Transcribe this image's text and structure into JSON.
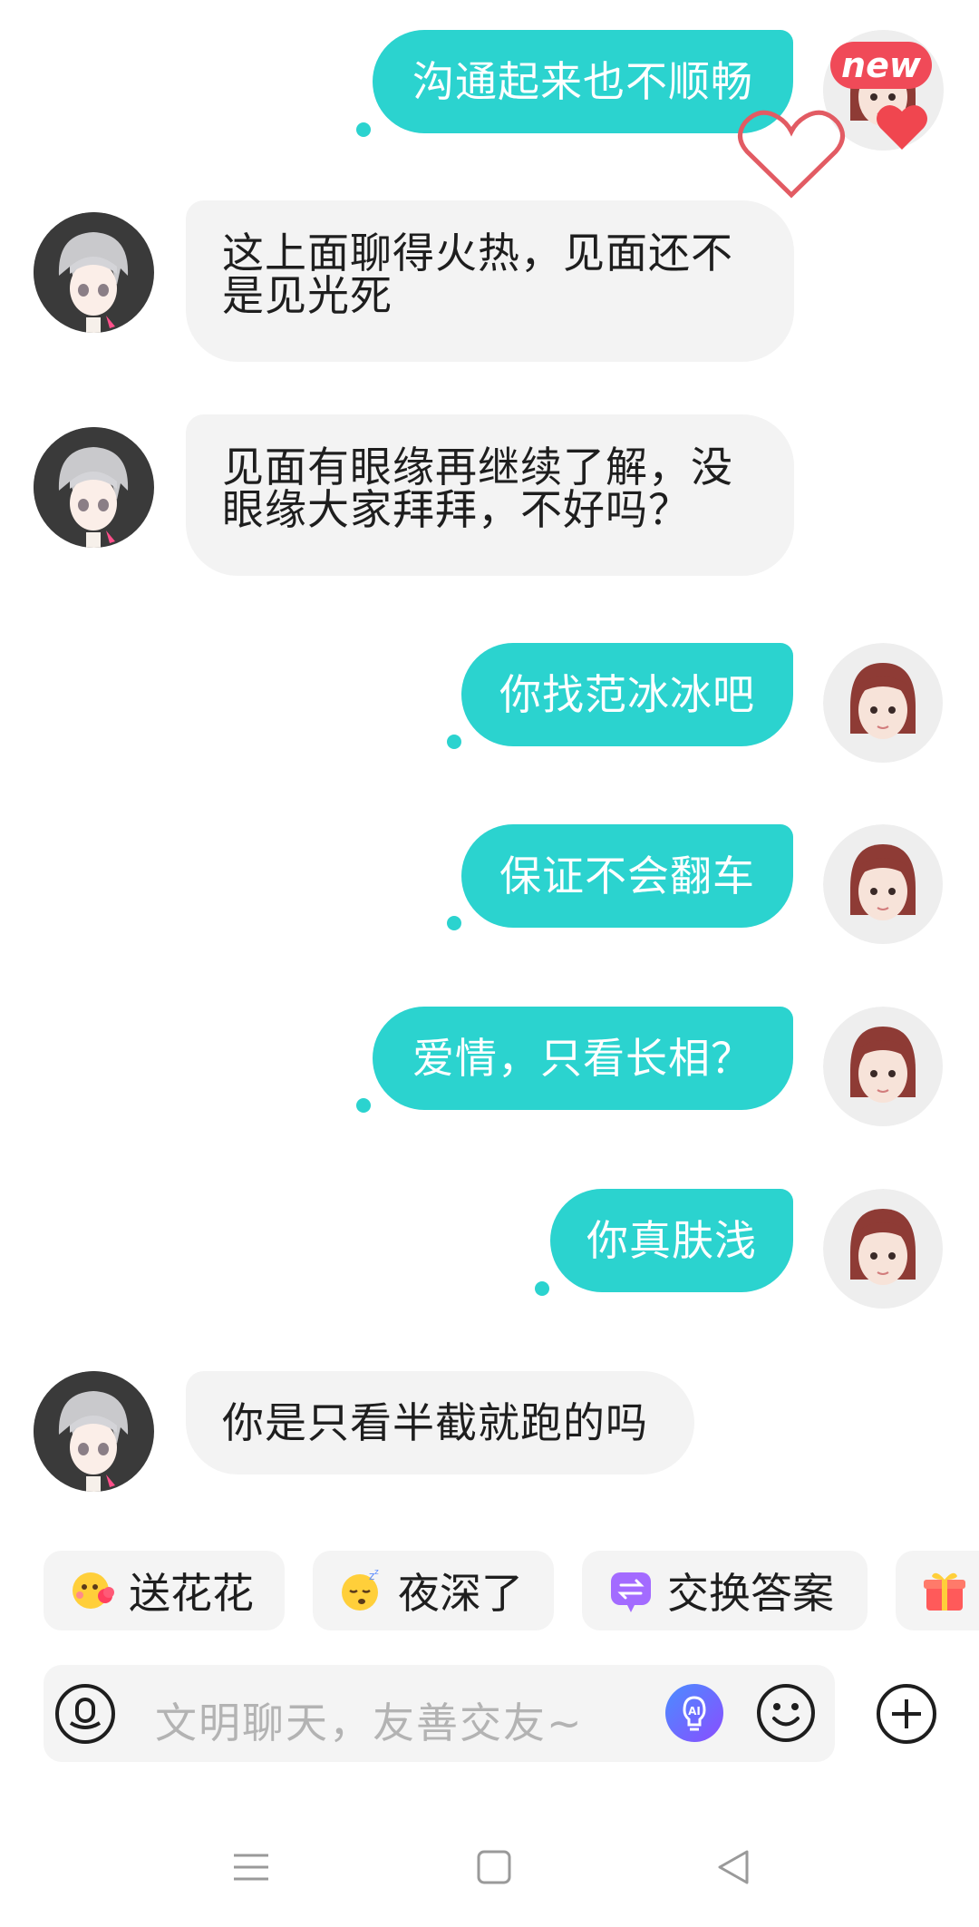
{
  "messages": [
    {
      "side": "me",
      "text": "沟通起来也不顺畅"
    },
    {
      "side": "them",
      "lines": [
        "这上面聊得火热，见面还不",
        "是见光死"
      ]
    },
    {
      "side": "them",
      "lines": [
        "见面有眼缘再继续了解，没",
        "眼缘大家拜拜，不好吗？"
      ]
    },
    {
      "side": "me",
      "text": "你找范冰冰吧"
    },
    {
      "side": "me",
      "text": "保证不会翻车"
    },
    {
      "side": "me",
      "text": "爱情，只看长相？"
    },
    {
      "side": "me",
      "text": "你真肤浅"
    },
    {
      "side": "them",
      "lines": [
        "你是只看半截就跑的吗"
      ]
    }
  ],
  "badge": {
    "new_label": "new"
  },
  "quick_actions": [
    {
      "label": "送花花",
      "icon": "flower-emoji-icon"
    },
    {
      "label": "夜深了",
      "icon": "sleepy-emoji-icon"
    },
    {
      "label": "交换答案",
      "icon": "exchange-icon"
    },
    {
      "label": "",
      "icon": "gift-icon"
    }
  ],
  "input": {
    "placeholder": "文明聊天，友善交友~",
    "ai_label": "AI"
  },
  "colors": {
    "accent": "#2bd3cf",
    "bubble_other": "#f3f3f3",
    "chip_bg": "#f4f4f4"
  }
}
